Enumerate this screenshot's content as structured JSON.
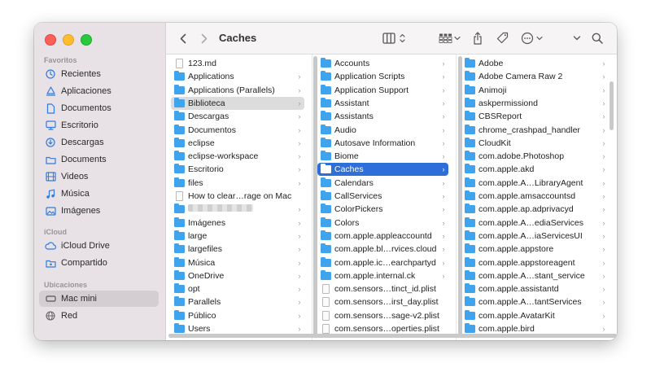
{
  "window": {
    "title": "Caches"
  },
  "sidebar": {
    "sections": [
      {
        "title": "Favoritos",
        "items": [
          {
            "label": "Recientes",
            "icon": "clock-icon"
          },
          {
            "label": "Aplicaciones",
            "icon": "applications-icon"
          },
          {
            "label": "Documentos",
            "icon": "document-icon"
          },
          {
            "label": "Escritorio",
            "icon": "desktop-icon"
          },
          {
            "label": "Descargas",
            "icon": "download-icon"
          },
          {
            "label": "Documents",
            "icon": "folder-icon"
          },
          {
            "label": "Videos",
            "icon": "film-icon"
          },
          {
            "label": "Música",
            "icon": "music-icon"
          },
          {
            "label": "Imágenes",
            "icon": "photo-icon"
          }
        ]
      },
      {
        "title": "iCloud",
        "items": [
          {
            "label": "iCloud Drive",
            "icon": "cloud-icon"
          },
          {
            "label": "Compartido",
            "icon": "shared-folder-icon"
          }
        ]
      },
      {
        "title": "Ubicaciones",
        "items": [
          {
            "label": "Mac mini",
            "icon": "computer-icon",
            "selected": true
          },
          {
            "label": "Red",
            "icon": "network-icon"
          }
        ]
      }
    ]
  },
  "colors": {
    "accent": "#2e6ed8",
    "folder": "#3fa3ee",
    "sidebar_bg": "#e8e1e6"
  },
  "columns": [
    {
      "items": [
        {
          "label": "123.md",
          "type": "doc",
          "chevron": false
        },
        {
          "label": "Applications",
          "type": "folder",
          "chevron": true
        },
        {
          "label": "Applications (Parallels)",
          "type": "folder",
          "chevron": true
        },
        {
          "label": "Biblioteca",
          "type": "folder",
          "chevron": true,
          "selected": "inactive"
        },
        {
          "label": "Descargas",
          "type": "folder",
          "chevron": true
        },
        {
          "label": "Documentos",
          "type": "folder",
          "chevron": true
        },
        {
          "label": "eclipse",
          "type": "folder",
          "chevron": true
        },
        {
          "label": "eclipse-workspace",
          "type": "folder",
          "chevron": true
        },
        {
          "label": "Escritorio",
          "type": "folder",
          "chevron": true
        },
        {
          "label": "files",
          "type": "folder",
          "chevron": true
        },
        {
          "label": "How to clear…rage on Mac",
          "type": "doc",
          "chevron": false
        },
        {
          "label": "",
          "type": "folder",
          "chevron": true,
          "blurred": true
        },
        {
          "label": "Imágenes",
          "type": "folder",
          "chevron": true
        },
        {
          "label": "large",
          "type": "folder",
          "chevron": true
        },
        {
          "label": "largefiles",
          "type": "folder",
          "chevron": true
        },
        {
          "label": "Música",
          "type": "folder",
          "chevron": true
        },
        {
          "label": "OneDrive",
          "type": "folder",
          "chevron": true
        },
        {
          "label": "opt",
          "type": "folder",
          "chevron": true
        },
        {
          "label": "Parallels",
          "type": "folder",
          "chevron": true
        },
        {
          "label": "Público",
          "type": "folder",
          "chevron": true
        },
        {
          "label": "Users",
          "type": "folder",
          "chevron": true
        }
      ]
    },
    {
      "items": [
        {
          "label": "Accounts",
          "type": "folder",
          "chevron": true
        },
        {
          "label": "Application Scripts",
          "type": "folder",
          "chevron": true
        },
        {
          "label": "Application Support",
          "type": "folder",
          "chevron": true
        },
        {
          "label": "Assistant",
          "type": "folder",
          "chevron": true
        },
        {
          "label": "Assistants",
          "type": "folder",
          "chevron": true
        },
        {
          "label": "Audio",
          "type": "folder",
          "chevron": true
        },
        {
          "label": "Autosave Information",
          "type": "folder",
          "chevron": true
        },
        {
          "label": "Biome",
          "type": "folder",
          "chevron": true
        },
        {
          "label": "Caches",
          "type": "folder",
          "chevron": true,
          "selected": "active"
        },
        {
          "label": "Calendars",
          "type": "folder",
          "chevron": true
        },
        {
          "label": "CallServices",
          "type": "folder",
          "chevron": true
        },
        {
          "label": "ColorPickers",
          "type": "folder",
          "chevron": true
        },
        {
          "label": "Colors",
          "type": "folder",
          "chevron": true
        },
        {
          "label": "com.apple.appleaccountd",
          "type": "folder",
          "chevron": true
        },
        {
          "label": "com.apple.bl…rvices.cloud",
          "type": "folder",
          "chevron": true
        },
        {
          "label": "com.apple.ic…earchpartyd",
          "type": "folder",
          "chevron": true
        },
        {
          "label": "com.apple.internal.ck",
          "type": "folder",
          "chevron": true
        },
        {
          "label": "com.sensors…tinct_id.plist",
          "type": "doc",
          "chevron": false
        },
        {
          "label": "com.sensors…irst_day.plist",
          "type": "doc",
          "chevron": false
        },
        {
          "label": "com.sensors…sage-v2.plist",
          "type": "doc",
          "chevron": false
        },
        {
          "label": "com.sensors…operties.plist",
          "type": "doc",
          "chevron": false
        }
      ]
    },
    {
      "items": [
        {
          "label": "Adobe",
          "type": "folder",
          "chevron": true
        },
        {
          "label": "Adobe Camera Raw 2",
          "type": "folder",
          "chevron": true
        },
        {
          "label": "Animoji",
          "type": "folder",
          "chevron": true
        },
        {
          "label": "askpermissiond",
          "type": "folder",
          "chevron": true
        },
        {
          "label": "CBSReport",
          "type": "folder",
          "chevron": true
        },
        {
          "label": "chrome_crashpad_handler",
          "type": "folder",
          "chevron": true
        },
        {
          "label": "CloudKit",
          "type": "folder",
          "chevron": true
        },
        {
          "label": "com.adobe.Photoshop",
          "type": "folder",
          "chevron": true
        },
        {
          "label": "com.apple.akd",
          "type": "folder",
          "chevron": true
        },
        {
          "label": "com.apple.A…LibraryAgent",
          "type": "folder",
          "chevron": true
        },
        {
          "label": "com.apple.amsaccountsd",
          "type": "folder",
          "chevron": true
        },
        {
          "label": "com.apple.ap.adprivacyd",
          "type": "folder",
          "chevron": true
        },
        {
          "label": "com.apple.A…ediaServices",
          "type": "folder",
          "chevron": true
        },
        {
          "label": "com.apple.A…iaServicesUI",
          "type": "folder",
          "chevron": true
        },
        {
          "label": "com.apple.appstore",
          "type": "folder",
          "chevron": true
        },
        {
          "label": "com.apple.appstoreagent",
          "type": "folder",
          "chevron": true
        },
        {
          "label": "com.apple.A…stant_service",
          "type": "folder",
          "chevron": true
        },
        {
          "label": "com.apple.assistantd",
          "type": "folder",
          "chevron": true
        },
        {
          "label": "com.apple.A…tantServices",
          "type": "folder",
          "chevron": true
        },
        {
          "label": "com.apple.AvatarKit",
          "type": "folder",
          "chevron": true
        },
        {
          "label": "com.apple.bird",
          "type": "folder",
          "chevron": true
        }
      ]
    }
  ]
}
